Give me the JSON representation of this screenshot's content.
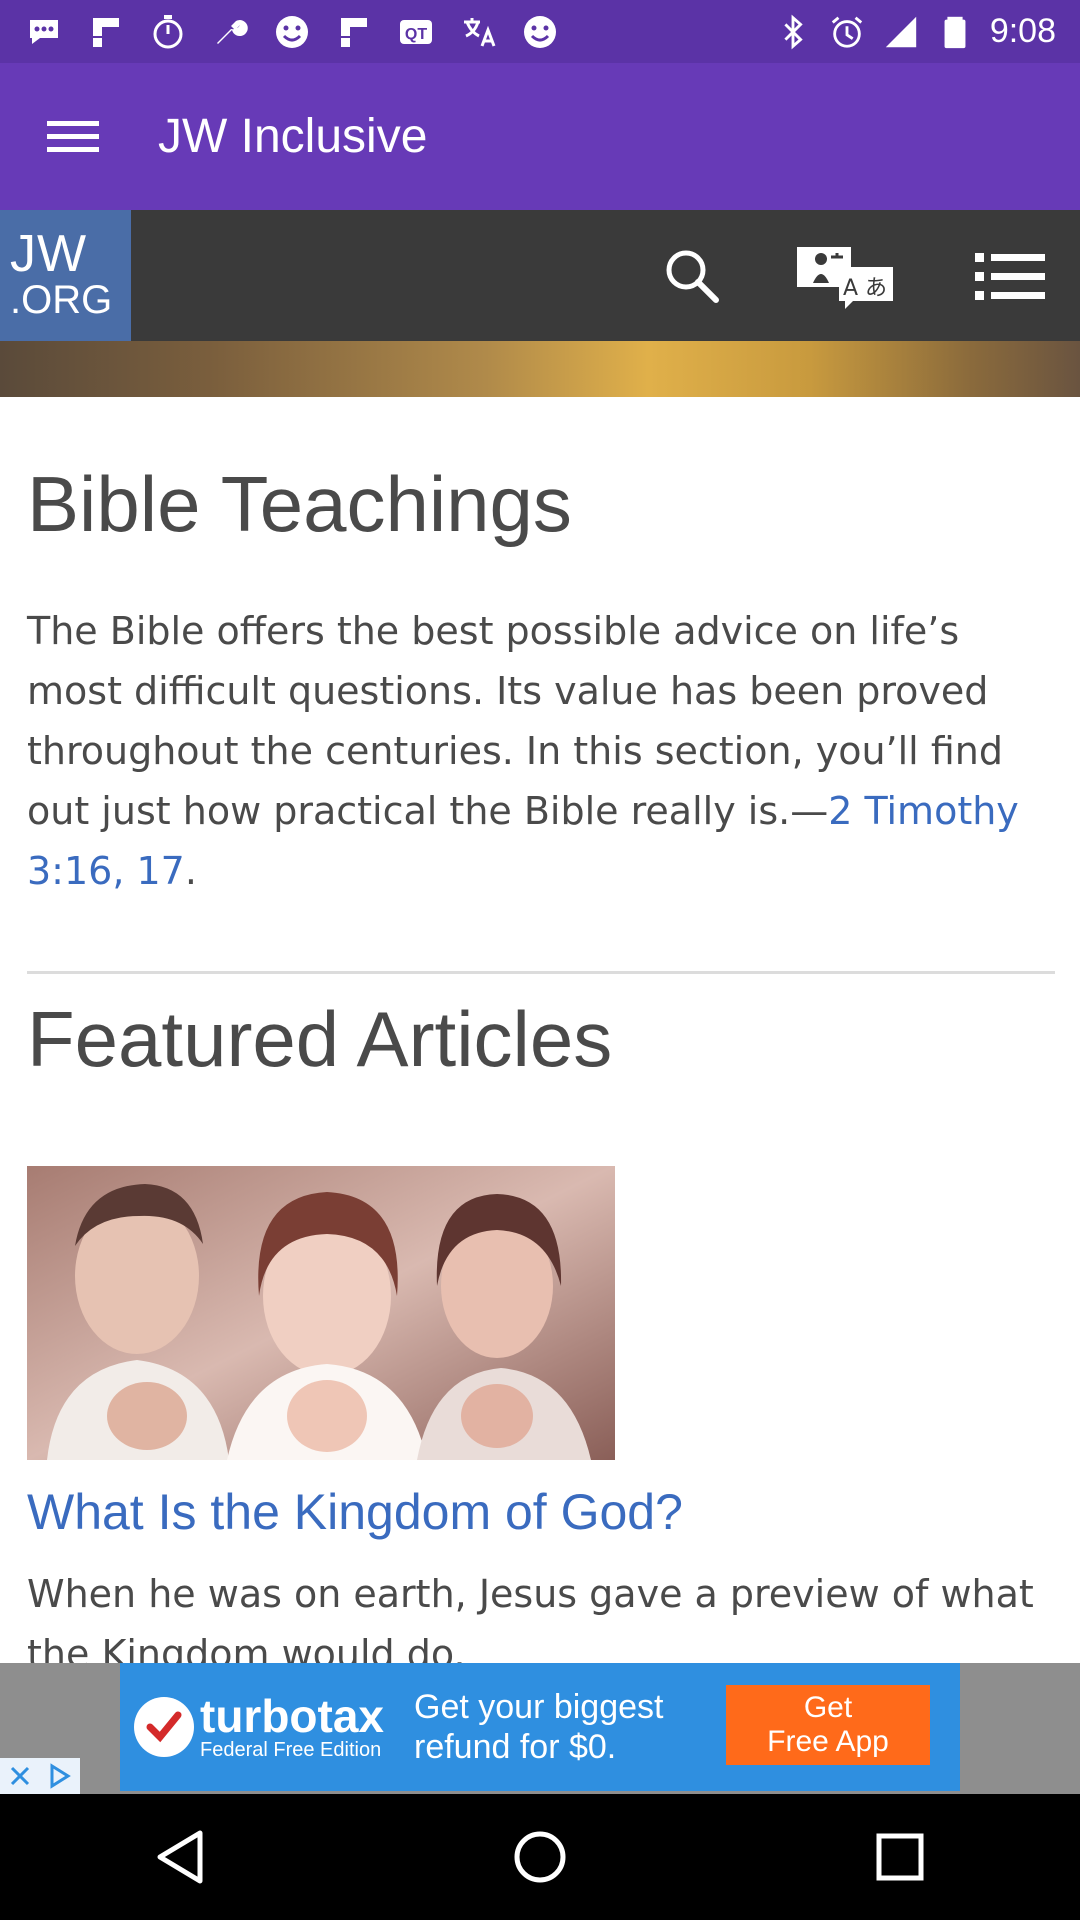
{
  "status_bar": {
    "time": "9:08",
    "icons": [
      "messenger-icon",
      "flipboard-icon",
      "stopwatch-icon",
      "wrench-icon",
      "smiley-icon",
      "flipboard-icon",
      "qt-icon",
      "translate-icon",
      "smiley-icon",
      "bluetooth-icon",
      "alarm-icon",
      "signal-icon",
      "battery-icon"
    ]
  },
  "app_bar": {
    "title": "JW Inclusive"
  },
  "site_header": {
    "logo_line1": "JW",
    "logo_line2": ".ORG",
    "actions": [
      "search-icon",
      "language-icon",
      "list-menu-icon"
    ]
  },
  "main": {
    "section_title": "Bible Teachings",
    "intro_text": "The Bible offers the best possible advice on life’s most difficult questions. Its value has been proved throughout the centuries. In this section, you’ll find out just how practical the Bible really is.—",
    "intro_link": "2 Timothy 3:16, 17",
    "intro_end": ".",
    "featured_title": "Featured Articles",
    "article": {
      "title": "What Is the Kingdom of God?",
      "description": "When he was on earth, Jesus gave a preview of what the Kingdom would do."
    }
  },
  "ad": {
    "brand": "turbotax",
    "brand_sub": "Federal Free Edition",
    "line1": "Get your biggest",
    "line2": "refund for $0.",
    "cta_line1": "Get",
    "cta_line2": "Free App"
  },
  "nav_bar": {
    "buttons": [
      "back-icon",
      "home-icon",
      "recents-icon"
    ]
  },
  "colors": {
    "status_bar": "#5b33a6",
    "app_bar": "#673ab7",
    "site_header": "#3a3a3a",
    "logo": "#4a6da7",
    "link": "#3a6bbf",
    "body_text": "#4a4a4a"
  }
}
